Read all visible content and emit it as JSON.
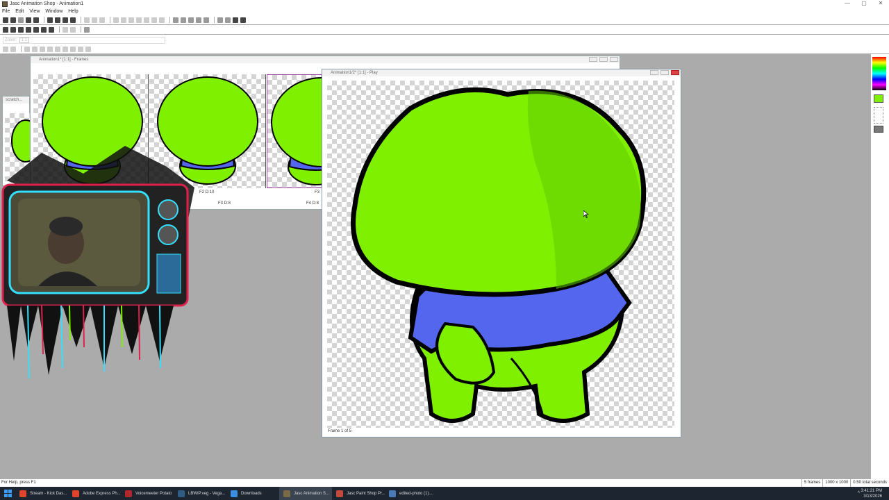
{
  "window": {
    "title": "Jasc Animation Shop - Animation1",
    "min": "—",
    "max": "▢",
    "close": "✕"
  },
  "menu": [
    "File",
    "Edit",
    "View",
    "Window",
    "Help"
  ],
  "zoom": {
    "label": "Zoom:",
    "value": "1:1"
  },
  "frames_window": {
    "title": "Animation1* [1:1] - Frames",
    "labels": {
      "f2": "F2  D:10",
      "f3": "F3  D:8",
      "f4": "F4  D:8",
      "f3b": "F3"
    }
  },
  "scratch_window": {
    "title": "scratch..."
  },
  "play_window": {
    "title": "Animation1/2* [1:1] - Play",
    "frame_info": "Frame 1 of 5"
  },
  "colors": {
    "fill": "#7ff000",
    "shirt": "#5566ee",
    "accent": "#7ff000"
  },
  "status": {
    "help": "For Help, press F1",
    "frames": "5 frames",
    "size": "1000 x 1000",
    "duration": "0.50 total seconds"
  },
  "taskbar": {
    "items": [
      {
        "label": "Stream - Kick Das...",
        "icon": "brave-icon",
        "color": "#e0442b"
      },
      {
        "label": "Adobe Express Ph...",
        "icon": "brave-icon",
        "color": "#e0442b"
      },
      {
        "label": "Voicemeeter Potato",
        "icon": "voicemeeter-icon",
        "color": "#b3262c"
      },
      {
        "label": "LBWIP.veg - Vega...",
        "icon": "vegas-icon",
        "color": "#2f5d85"
      },
      {
        "label": "Downloads",
        "icon": "download-icon",
        "color": "#3b8de0"
      },
      {
        "label": "Jasc Animation S...",
        "icon": "animation-shop-icon",
        "color": "#7a6a45"
      },
      {
        "label": "Jasc Paint Shop Pr...",
        "icon": "paint-shop-icon",
        "color": "#c24a3b"
      },
      {
        "label": "edited-photo (1)....",
        "icon": "photos-icon",
        "color": "#4a7bb8"
      }
    ],
    "time": "3:41:21 PM",
    "date": "3/13/2026",
    "tray": "^"
  }
}
